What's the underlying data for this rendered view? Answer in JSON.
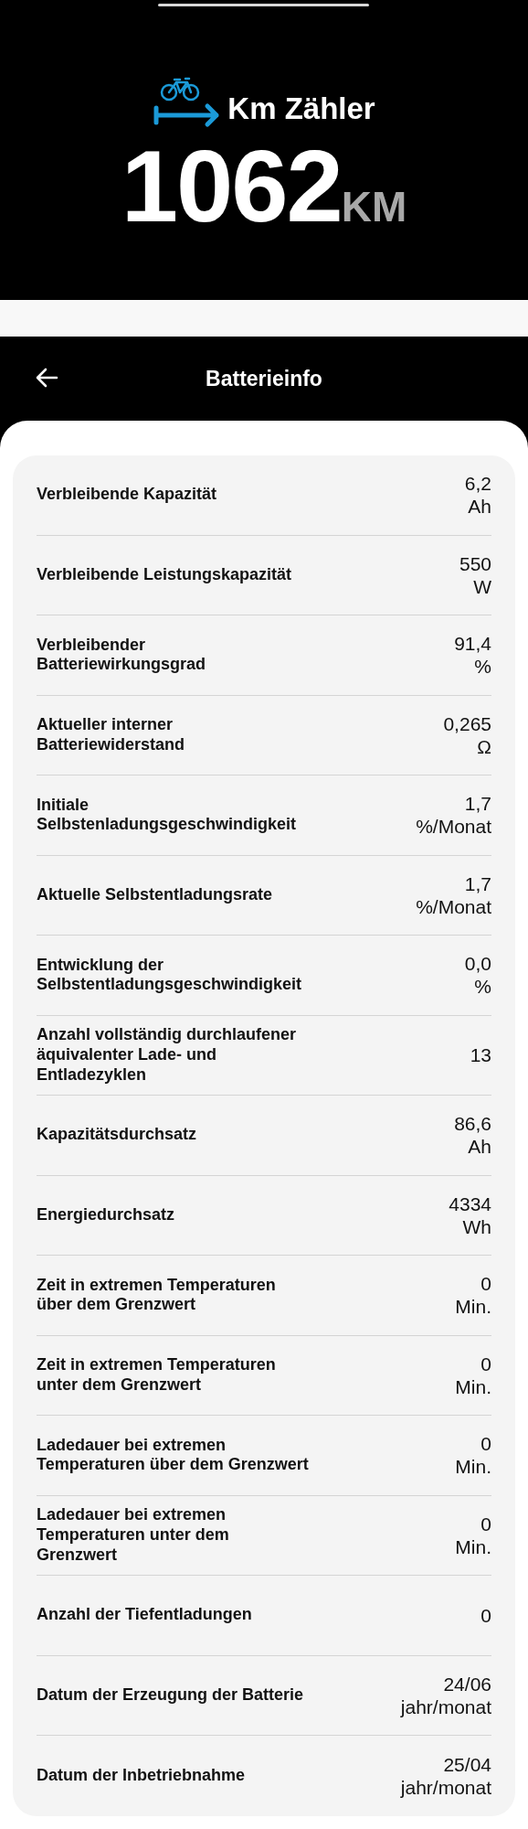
{
  "odometer": {
    "title": "Km Zähler",
    "value": "1062",
    "unit": "KM"
  },
  "header": {
    "title": "Batterieinfo"
  },
  "rows": [
    {
      "label": "Verbleibende Kapazität",
      "value": "6,2",
      "unit": "Ah"
    },
    {
      "label": "Verbleibende Leistungskapazität",
      "value": "550",
      "unit": "W"
    },
    {
      "label": "Verbleibender Batteriewirkungsgrad",
      "value": "91,4",
      "unit": "%"
    },
    {
      "label": "Aktueller interner Batteriewiderstand",
      "value": "0,265",
      "unit": "Ω"
    },
    {
      "label": "Initiale Selbstenladungsgeschwindigkeit",
      "value": "1,7",
      "unit": "%/Monat"
    },
    {
      "label": "Aktuelle Selbstentladungsrate",
      "value": "1,7",
      "unit": "%/Monat"
    },
    {
      "label": "Entwicklung der Selbstentladungsgeschwindigkeit",
      "value": "0,0",
      "unit": "%"
    },
    {
      "label": "Anzahl vollständig durchlaufener äquivalenter Lade- und Entladezyklen",
      "value": "13"
    },
    {
      "label": "Kapazitätsdurchsatz",
      "value": "86,6",
      "unit": "Ah"
    },
    {
      "label": "Energiedurchsatz",
      "value": "4334",
      "unit": "Wh"
    },
    {
      "label": "Zeit in extremen Temperaturen über dem Grenzwert",
      "value": "0",
      "unit": "Min."
    },
    {
      "label": "Zeit in extremen Temperaturen unter dem Grenzwert",
      "value": "0",
      "unit": "Min."
    },
    {
      "label": "Ladedauer bei extremen Temperaturen über dem Grenzwert",
      "value": "0",
      "unit": "Min."
    },
    {
      "label": "Ladedauer bei extremen Temperaturen unter dem Grenzwert",
      "value": "0",
      "unit": "Min."
    },
    {
      "label": "Anzahl der Tiefentladungen",
      "value": "0"
    },
    {
      "label": "Datum der Erzeugung der Batterie",
      "value": "24/06",
      "unit": "jahr/monat"
    },
    {
      "label": "Datum der Inbetriebnahme",
      "value": "25/04",
      "unit": "jahr/monat"
    }
  ]
}
